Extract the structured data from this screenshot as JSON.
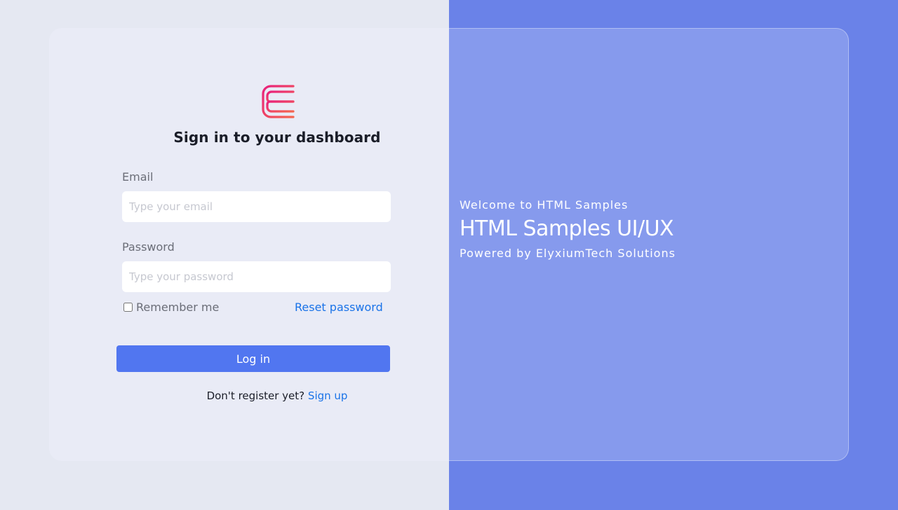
{
  "login": {
    "title": "Sign in to your dashboard",
    "email_label": "Email",
    "email_placeholder": "Type your email",
    "email_value": "",
    "password_label": "Password",
    "password_placeholder": "Type your password",
    "password_value": "",
    "remember_label": "Remember me",
    "remember_checked": false,
    "reset_label": "Reset password",
    "login_button": "Log in",
    "signup_prompt": "Don't register yet?",
    "signup_link": "Sign up"
  },
  "promo": {
    "welcome": "Welcome to HTML Samples",
    "headline": "HTML Samples UI/UX",
    "powered_by": "Powered by ElyxiumTech Solutions"
  },
  "colors": {
    "brand_gradient_start": "#e8207c",
    "brand_gradient_end": "#f26a5a",
    "primary_button": "#5176f0",
    "link": "#1a73e8",
    "right_panel": "#6a82e8"
  },
  "icons": {
    "logo": "elyxium-e-logo-icon"
  }
}
